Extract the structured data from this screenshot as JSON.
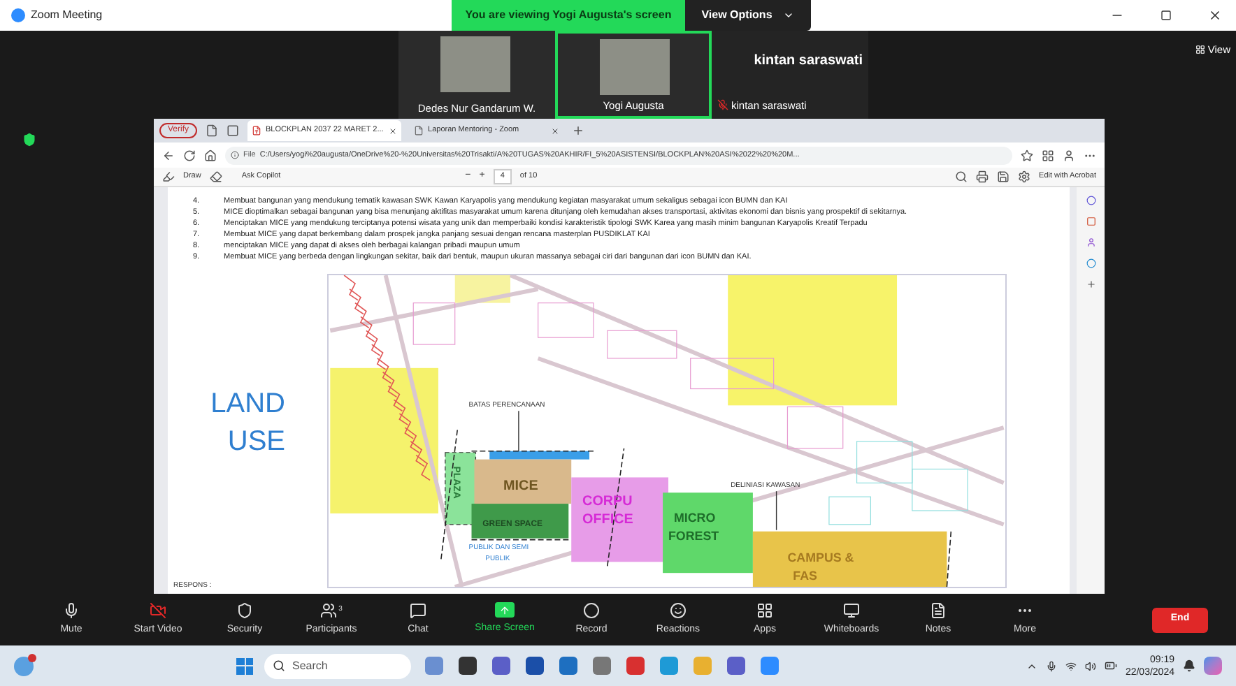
{
  "title_bar": {
    "title": "Zoom Meeting",
    "banner": "You are viewing Yogi Augusta's screen",
    "view_options": "View Options"
  },
  "participants": [
    {
      "name": "Dedes Nur Gandarum W.",
      "kind": "photo",
      "active": false,
      "muted": false
    },
    {
      "name": "Yogi Augusta",
      "kind": "photo",
      "active": true,
      "muted": false
    },
    {
      "name": "kintan saraswati",
      "display": "kintan saraswati",
      "kind": "name",
      "active": false,
      "muted": true
    }
  ],
  "view_button": "View",
  "browser": {
    "profile": "Verify",
    "tabs": [
      {
        "label": "BLOCKPLAN 2037 22 MARET 2...",
        "kind": "pdf",
        "selected": true
      },
      {
        "label": "Laporan Mentoring - Zoom",
        "kind": "page",
        "selected": false
      }
    ],
    "address_prefix": "File",
    "address": "C:/Users/yogi%20augusta/OneDrive%20-%20Universitas%20Trisakti/A%20TUGAS%20AKHIR/FI_5%20ASISTENSI/BLOCKPLAN%20ASI%2022%20%20M...",
    "pdf_toolbar": {
      "draw": "Draw",
      "copilot": "Ask Copilot",
      "minus": "−",
      "plus": "+",
      "page": "4",
      "of": "of 10",
      "edit": "Edit with Acrobat"
    }
  },
  "document": {
    "items": [
      {
        "number": "4.",
        "text": "Membuat bangunan yang mendukung tematik kawasan SWK Kawan Karyapolis yang mendukung kegiatan masyarakat umum sekaligus sebagai icon BUMN dan KAI"
      },
      {
        "number": "5.",
        "text": "MICE dioptimalkan sebagai bangunan yang bisa menunjang aktifitas masyarakat umum karena ditunjang oleh kemudahan akses transportasi, aktivitas ekonomi dan bisnis yang prospektif di sekitarnya."
      },
      {
        "number": "6.",
        "text": "Menciptakan MICE yang mendukung terciptanya potensi wisata yang unik dan memperbaiki kondisi karakteristik tipologi SWK Karea yang masih minim bangunan Karyapolis Kreatif Terpadu"
      },
      {
        "number": "7.",
        "text": "Membuat MICE yang dapat berkembang dalam prospek jangka panjang sesuai dengan rencana masterplan PUSDIKLAT KAI"
      },
      {
        "number": "8.",
        "text": "menciptakan MICE yang dapat di akses oleh berbagai kalangan pribadi maupun umum"
      },
      {
        "number": "9.",
        "text": "Membuat MICE yang berbeda dengan lingkungan sekitar, baik dari bentuk, maupun ukuran massanya sebagai ciri dari bangunan dari icon BUMN dan KAI."
      }
    ],
    "land_use": [
      "LAND",
      "USE"
    ],
    "map": {
      "boundary": "BATAS PERENCANAAN",
      "plaza": "PLAZA",
      "mice": "MICE",
      "green_space": "GREEN SPACE",
      "corpu": [
        "CORPU",
        "OFFICE"
      ],
      "forest": [
        "MICRO",
        "FOREST"
      ],
      "campus": [
        "CAMPUS &",
        "FAS"
      ],
      "delineation": "DELINIASI KAWASAN",
      "public": [
        "PUBLIK DAN SEMI",
        "PUBLIK"
      ]
    },
    "footer": "RESPONS :"
  },
  "toolbar": [
    {
      "label": "Mute",
      "kind": "mic",
      "active": false
    },
    {
      "label": "Start Video",
      "kind": "video_off",
      "active": false
    },
    {
      "label": "Security",
      "kind": "shield",
      "active": false
    },
    {
      "label": "Participants",
      "kind": "people",
      "count": "3",
      "active": false
    },
    {
      "label": "Chat",
      "kind": "chat",
      "active": false
    },
    {
      "label": "Share Screen",
      "kind": "share",
      "active": true
    },
    {
      "label": "Record",
      "kind": "record",
      "active": false
    },
    {
      "label": "Reactions",
      "kind": "smile",
      "active": false
    },
    {
      "label": "Apps",
      "kind": "apps",
      "active": false
    },
    {
      "label": "Whiteboards",
      "kind": "board",
      "active": false
    },
    {
      "label": "Notes",
      "kind": "notes",
      "active": false
    },
    {
      "label": "More",
      "kind": "more",
      "active": false
    }
  ],
  "end_button": "End",
  "taskbar": {
    "search": "Search",
    "time": "09:19",
    "date": "22/03/2024"
  }
}
